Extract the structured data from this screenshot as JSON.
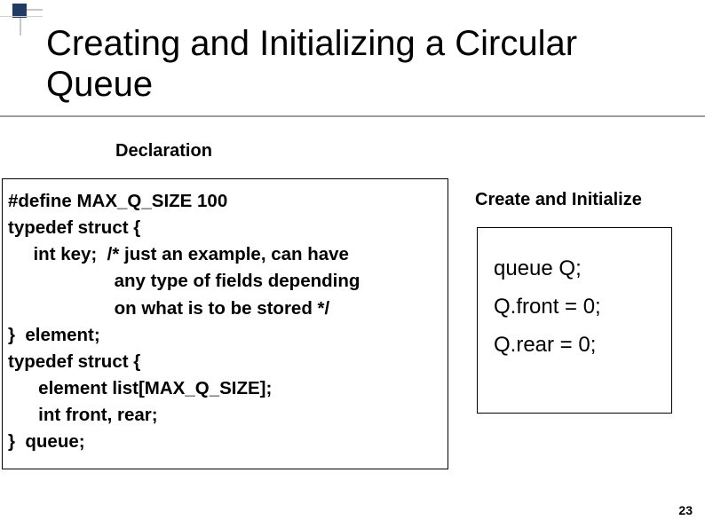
{
  "title": "Creating and Initializing a Circular Queue",
  "subtitle_declaration": "Declaration",
  "subtitle_create": "Create and Initialize",
  "decl": {
    "l1": "#define MAX_Q_SIZE 100",
    "l2": "typedef struct {",
    "l3": "     int key;  /* just an example, can have",
    "l4": "                     any type of fields depending",
    "l5": "                     on what is to be stored */",
    "l6": "}  element;",
    "l7": "typedef struct {",
    "l8": "      element list[MAX_Q_SIZE];",
    "l9": "      int front, rear;",
    "l10": "}  queue;"
  },
  "init": {
    "l1": "queue Q;",
    "l2": "Q.front = 0;",
    "l3": "Q.rear = 0;"
  },
  "page_number": "23"
}
